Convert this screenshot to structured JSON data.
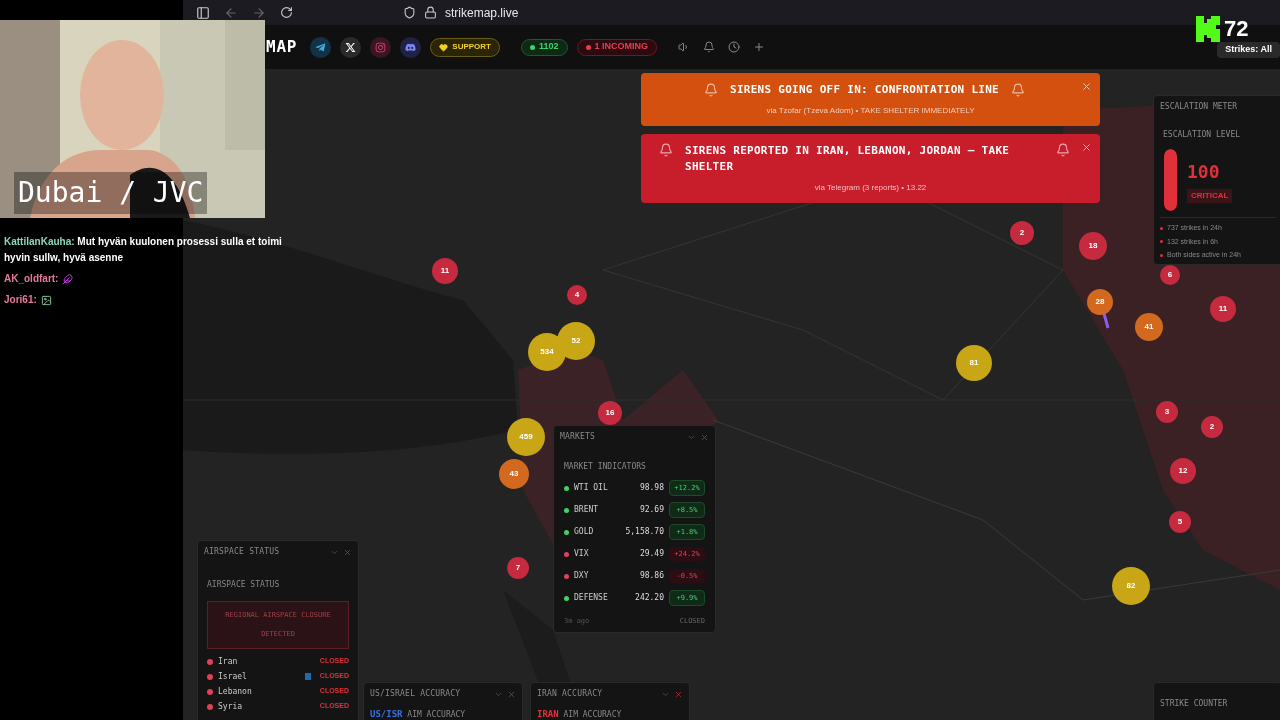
{
  "stream": {
    "overlay_text": "Dubai / JVC",
    "viewer_count": "72"
  },
  "chat": [
    {
      "user": "KattilanKauha:",
      "color": "#8ad9bb",
      "kind": "text",
      "text": "Mut hyvän kuulonen prosessi sulla et toimi hyvin sullw, hyvä asenne"
    },
    {
      "user": "AK_oldfart:",
      "color": "#e47a9c",
      "kind": "emote"
    },
    {
      "user": "Jori61:",
      "color": "#e47a9c",
      "kind": "emote"
    }
  ],
  "browser": {
    "url": "strikemap.live"
  },
  "header": {
    "title": "MAP",
    "support": "SUPPORT",
    "count": "1102",
    "incoming": "1 INCOMING",
    "strikes_filter": "Strikes: All"
  },
  "alerts": [
    {
      "title": "SIRENS GOING OFF IN: CONFRONTATION LINE",
      "source": "via Tzofar (Tzeva Adom) • TAKE SHELTER IMMEDIATELY",
      "color": "#d4500f"
    },
    {
      "title": "SIRENS REPORTED IN IRAN, LEBANON, JORDAN — TAKE SHELTER",
      "source": "via Telegram (3 reports) • 13.22",
      "color": "#c81e2c"
    }
  ],
  "escalation": {
    "title": "ESCALATION METER",
    "label": "ESCALATION LEVEL",
    "value": "100",
    "status": "CRITICAL",
    "level": 1,
    "stats": [
      "737 strikes in 24h",
      "132 strikes in 6h",
      "Both sides active in 24h"
    ]
  },
  "markets": {
    "title": "MARKETS",
    "subtitle": "MARKET INDICATORS",
    "rows": [
      {
        "name": "WTI OIL",
        "value": "98.98",
        "change": "+12.2%",
        "positive": true
      },
      {
        "name": "BRENT",
        "value": "92.69",
        "change": "+8.5%",
        "positive": true
      },
      {
        "name": "GOLD",
        "value": "5,158.70",
        "change": "+1.8%",
        "positive": true
      },
      {
        "name": "VIX",
        "value": "29.49",
        "change": "+24.2%",
        "positive": false
      },
      {
        "name": "DXY",
        "value": "98.86",
        "change": "-0.5%",
        "positive": false
      },
      {
        "name": "DEFENSE",
        "value": "242.20",
        "change": "+9.9%",
        "positive": true
      }
    ],
    "updated": "3m ago",
    "status": "CLOSED"
  },
  "airspace": {
    "title": "AIRSPACE STATUS",
    "subtitle": "AIRSPACE STATUS",
    "notice": "REGIONAL AIRSPACE CLOSURE DETECTED",
    "countries": [
      {
        "name": "Iran",
        "status": "CLOSED",
        "flagged": false
      },
      {
        "name": "Israel",
        "status": "CLOSED",
        "flagged": true
      },
      {
        "name": "Lebanon",
        "status": "CLOSED",
        "flagged": false
      },
      {
        "name": "Syria",
        "status": "CLOSED",
        "flagged": false
      }
    ]
  },
  "accuracy": [
    {
      "title": "US/ISRAEL ACCURACY",
      "prefix": "US/ISR",
      "label": "AIM ACCURACY",
      "color": "#3b6fe0"
    },
    {
      "title": "IRAN ACCURACY",
      "prefix": "IRAN",
      "label": "AIM ACCURACY",
      "color": "#e0303c"
    }
  ],
  "strike_counter": {
    "title": "STRIKE COUNTER"
  },
  "clusters": [
    {
      "label": "11",
      "color": "#c62a3e"
    },
    {
      "label": "4",
      "color": "#c62a3e"
    },
    {
      "label": "52",
      "color": "#c9a616"
    },
    {
      "label": "534",
      "color": "#c9a616"
    },
    {
      "label": "16",
      "color": "#c62a3e"
    },
    {
      "label": "459",
      "color": "#c9a616"
    },
    {
      "label": "43",
      "color": "#d2691e"
    },
    {
      "label": "7",
      "color": "#c62a3e"
    },
    {
      "label": "2",
      "color": "#c62a3e"
    },
    {
      "label": "18",
      "color": "#c62a3e"
    },
    {
      "label": "28",
      "color": "#d2691e"
    },
    {
      "label": "41",
      "color": "#d2691e"
    },
    {
      "label": "6",
      "color": "#c62a3e"
    },
    {
      "label": "11",
      "color": "#c62a3e"
    },
    {
      "label": "81",
      "color": "#c9a616"
    },
    {
      "label": "3",
      "color": "#c62a3e"
    },
    {
      "label": "2",
      "color": "#c62a3e"
    },
    {
      "label": "12",
      "color": "#c62a3e"
    },
    {
      "label": "5",
      "color": "#c62a3e"
    },
    {
      "label": "82",
      "color": "#c9a616"
    }
  ]
}
